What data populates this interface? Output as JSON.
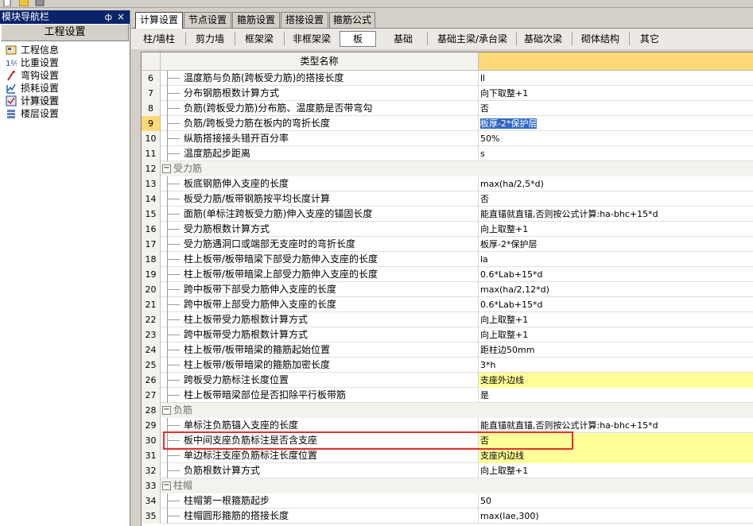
{
  "nav": {
    "title": "模块导航栏",
    "pin": "ф",
    "close": "×",
    "header": "工程设置",
    "items": [
      {
        "label": "工程信息",
        "icon": "project-info-icon"
      },
      {
        "label": "比重设置",
        "icon": "weight-settings-icon"
      },
      {
        "label": "弯钩设置",
        "icon": "hook-settings-icon"
      },
      {
        "label": "损耗设置",
        "icon": "loss-settings-icon"
      },
      {
        "label": "计算设置",
        "icon": "calc-settings-icon"
      },
      {
        "label": "楼层设置",
        "icon": "floor-settings-icon"
      }
    ]
  },
  "tabs": [
    "计算设置",
    "节点设置",
    "箍筋设置",
    "搭接设置",
    "箍筋公式"
  ],
  "subtabs": [
    "柱/墙柱",
    "剪力墙",
    "框架梁",
    "非框架梁",
    "板",
    "基础",
    "基础主梁/承台梁",
    "基础次梁",
    "砌体结构",
    "其它"
  ],
  "grid": {
    "header": "类型名称",
    "rows": [
      {
        "num": "6",
        "name": "温度筋与负筋(跨板受力筋)的搭接长度",
        "value": "ll"
      },
      {
        "num": "7",
        "name": "分布钢筋根数计算方式",
        "value": "向下取整+1"
      },
      {
        "num": "8",
        "name": "负筋(跨板受力筋)分布筋、温度筋是否带弯勾",
        "value": "否"
      },
      {
        "num": "9",
        "name": "负筋/跨板受力筋在板内的弯折长度",
        "value": "板厚-2*保护层"
      },
      {
        "num": "10",
        "name": "纵筋搭接接头错开百分率",
        "value": "50%"
      },
      {
        "num": "11",
        "name": "温度筋起步距离",
        "value": "s"
      },
      {
        "num": "12",
        "name": "受力筋",
        "value": ""
      },
      {
        "num": "13",
        "name": "板底钢筋伸入支座的长度",
        "value": "max(ha/2,5*d)"
      },
      {
        "num": "14",
        "name": "板受力筋/板带钢筋按平均长度计算",
        "value": "否"
      },
      {
        "num": "15",
        "name": "面筋(单标注跨板受力筋)伸入支座的锚固长度",
        "value": "能直锚就直锚,否则按公式计算:ha-bhc+15*d"
      },
      {
        "num": "16",
        "name": "受力筋根数计算方式",
        "value": "向上取整+1"
      },
      {
        "num": "17",
        "name": "受力筋遇洞口或端部无支座时的弯折长度",
        "value": "板厚-2*保护层"
      },
      {
        "num": "18",
        "name": "柱上板带/板带暗梁下部受力筋伸入支座的长度",
        "value": "la"
      },
      {
        "num": "19",
        "name": "柱上板带/板带暗梁上部受力筋伸入支座的长度",
        "value": "0.6*Lab+15*d"
      },
      {
        "num": "20",
        "name": "跨中板带下部受力筋伸入支座的长度",
        "value": "max(ha/2,12*d)"
      },
      {
        "num": "21",
        "name": "跨中板带上部受力筋伸入支座的长度",
        "value": "0.6*Lab+15*d"
      },
      {
        "num": "22",
        "name": "柱上板带受力筋根数计算方式",
        "value": "向上取整+1"
      },
      {
        "num": "23",
        "name": "跨中板带受力筋根数计算方式",
        "value": "向上取整+1"
      },
      {
        "num": "24",
        "name": "柱上板带/板带暗梁的箍筋起始位置",
        "value": "距柱边50mm"
      },
      {
        "num": "25",
        "name": "柱上板带/板带暗梁的箍筋加密长度",
        "value": "3*h"
      },
      {
        "num": "26",
        "name": "跨板受力筋标注长度位置",
        "value": "支座外边线"
      },
      {
        "num": "27",
        "name": "柱上板带暗梁部位是否扣除平行板带筋",
        "value": "是"
      },
      {
        "num": "28",
        "name": "负筋",
        "value": ""
      },
      {
        "num": "29",
        "name": "单标注负筋锚入支座的长度",
        "value": "能直锚就直锚,否则按公式计算:ha-bhc+15*d"
      },
      {
        "num": "30",
        "name": "板中间支座负筋标注是否含支座",
        "value": "否"
      },
      {
        "num": "31",
        "name": "单边标注支座负筋标注长度位置",
        "value": "支座内边线"
      },
      {
        "num": "32",
        "name": "负筋根数计算方式",
        "value": "向上取整+1"
      },
      {
        "num": "33",
        "name": "柱帽",
        "value": ""
      },
      {
        "num": "34",
        "name": "柱帽第一根箍筋起步",
        "value": "50"
      },
      {
        "num": "35",
        "name": "柱帽圆形箍筋的搭接长度",
        "value": "max(lae,300)"
      }
    ]
  },
  "colors": {
    "title_bar": "#0a246a",
    "header_value": "#ffd977",
    "yellow_cell": "#ffff99",
    "selection": "#3169c6",
    "annotation": "#e03030"
  }
}
